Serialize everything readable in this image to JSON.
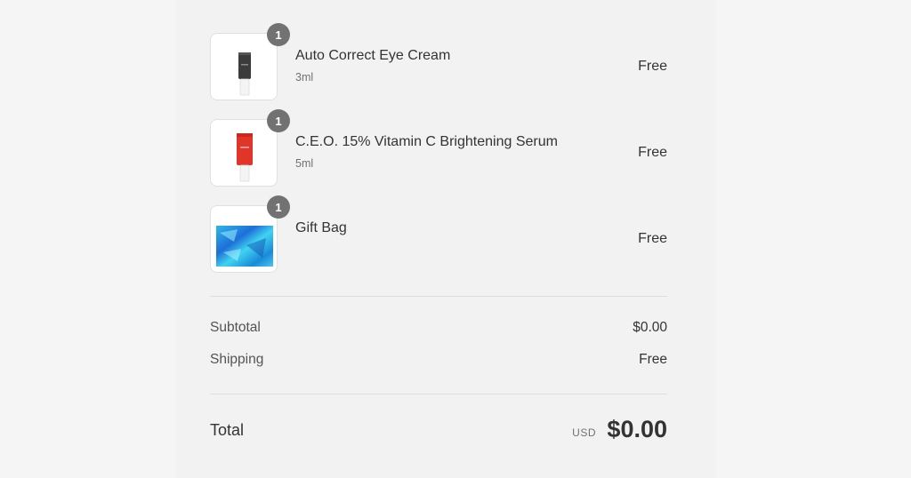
{
  "order_summary": {
    "items": [
      {
        "name": "Auto Correct Eye Cream",
        "variant": "3ml",
        "quantity": "1",
        "price": "Free",
        "image_icon": "eye-cream-tube-icon"
      },
      {
        "name": "C.E.O. 15% Vitamin C Brightening Serum",
        "variant": "5ml",
        "quantity": "1",
        "price": "Free",
        "image_icon": "serum-tube-icon"
      },
      {
        "name": "Gift Bag",
        "variant": "",
        "quantity": "1",
        "price": "Free",
        "image_icon": "gift-bag-icon"
      }
    ],
    "subtotal_label": "Subtotal",
    "subtotal_value": "$0.00",
    "shipping_label": "Shipping",
    "shipping_value": "Free",
    "total_label": "Total",
    "currency": "USD",
    "total_value": "$0.00"
  },
  "colors": {
    "badge": "#727272",
    "page_background": "#f5f5f5",
    "panel_background": "#f2f2f2",
    "text": "#333333"
  }
}
